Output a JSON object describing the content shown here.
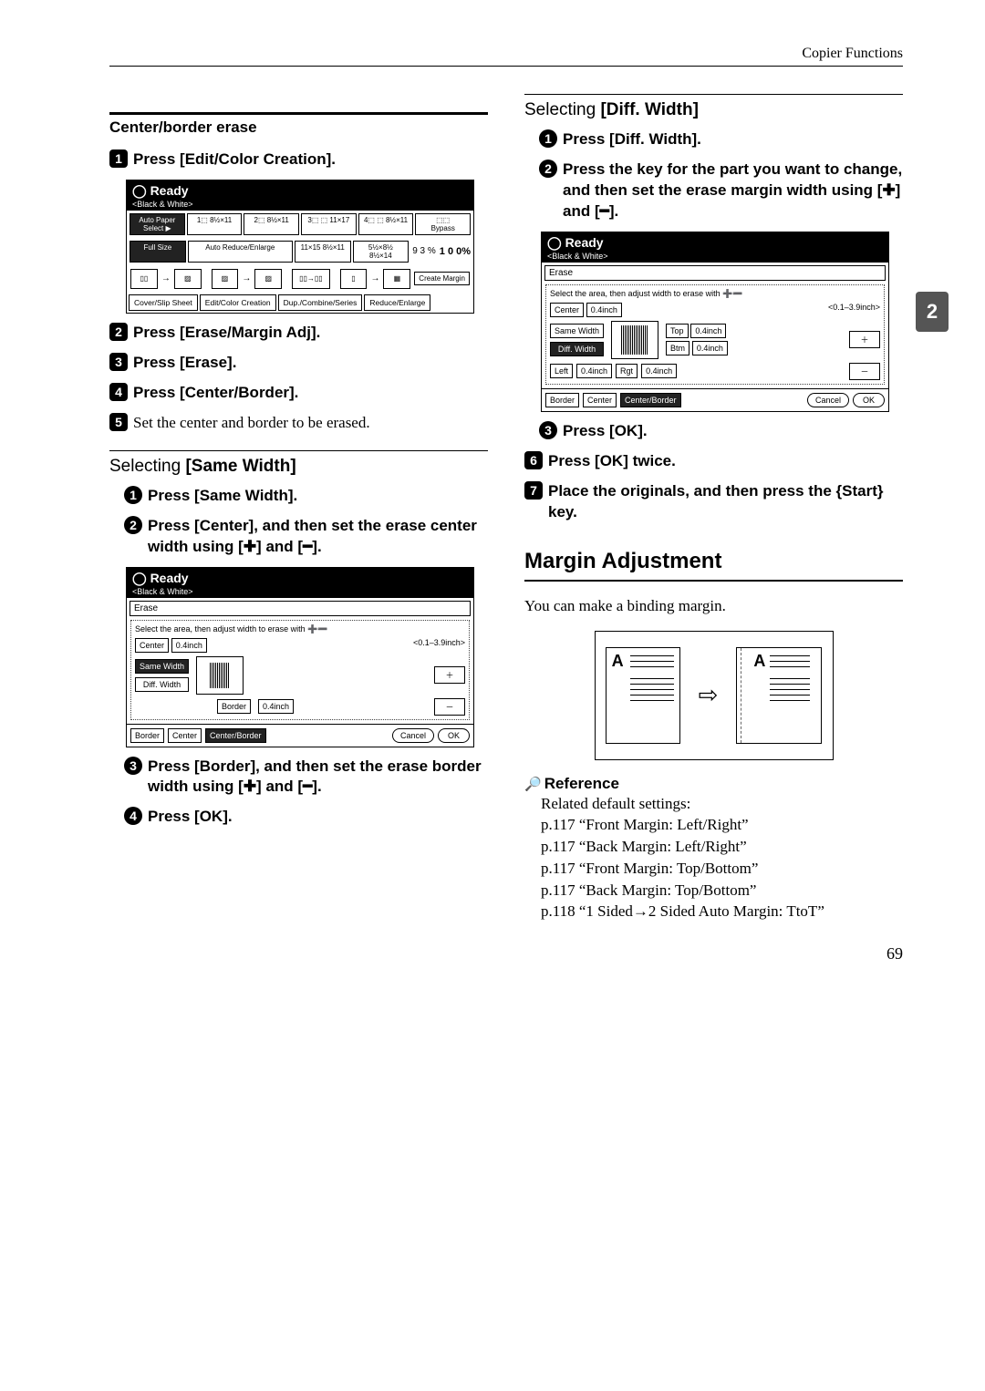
{
  "header": {
    "section": "Copier Functions"
  },
  "page_tab": "2",
  "footer_page": "69",
  "left": {
    "subsection": "Center/border erase",
    "step1": {
      "prefix": "Press ",
      "label": "[Edit/Color Creation]."
    },
    "panel1": {
      "ready": "Ready",
      "mode": "<Black & White>",
      "auto_paper": "Auto Paper\nSelect ▶",
      "p1": "1⬚\n8½×11",
      "p2": "2⬚\n8½×11",
      "p3": "3⬚ ⬚\n11×17",
      "p4": "4⬚ ⬚\n8½×11",
      "full_size": "Full Size",
      "auto_re": "Auto Reduce/Enlarge",
      "s1": "11×15\n8½×11",
      "s2": "5½×8½\n8½×14",
      "ratio": "9 3 %",
      "hundred": "1 0 0%",
      "create_margin": "Create\nMargin",
      "tabs": [
        "Cover/Slip Sheet",
        "Edit/Color Creation",
        "Dup./Combine/Series",
        "Reduce/Enlarge"
      ]
    },
    "step2": {
      "prefix": "Press ",
      "label": "[Erase/Margin Adj]."
    },
    "step3": {
      "prefix": "Press ",
      "label": "[Erase]."
    },
    "step4": {
      "prefix": "Press ",
      "label": "[Center/Border]."
    },
    "step5": {
      "text": "Set the center and border to be erased."
    },
    "selecting1_title": "Selecting ",
    "selecting1_label": "[Same Width]",
    "sub1_step1": {
      "prefix": "Press ",
      "label": "[Same Width]."
    },
    "sub1_step2": {
      "pre": "Press ",
      "label1": "[Center]",
      "mid": ", and then set the erase center width using ",
      "plus": "[✚]",
      "and": " and ",
      "minus": "[━]",
      "end": "."
    },
    "panel2": {
      "ready": "Ready",
      "mode": "<Black & White>",
      "erase": "Erase",
      "instr": "Select the area, then adjust width to erase with ➕➖",
      "center_btn": "Center",
      "center_val": "0.4inch",
      "range": "<0.1–3.9inch>",
      "same_width": "Same Width",
      "diff_width": "Diff. Width",
      "border_btn": "Border",
      "border_val": "0.4inch",
      "bottom": [
        "Border",
        "Center",
        "Center/Border",
        "Cancel",
        "OK"
      ]
    },
    "sub1_step3": {
      "pre": "Press ",
      "label1": "[Border]",
      "mid": ", and then set the erase border width using ",
      "plus": "[✚]",
      "and": " and ",
      "minus": "[━]",
      "end": "."
    },
    "sub1_step4": {
      "prefix": "Press ",
      "label": "[OK]."
    }
  },
  "right": {
    "selecting2_title": "Selecting ",
    "selecting2_label": "[Diff. Width]",
    "sub2_step1": {
      "prefix": "Press ",
      "label": "[Diff. Width]."
    },
    "sub2_step2": {
      "text": "Press the key for the part you want to change, and then set the erase margin width using ",
      "plus": "[✚]",
      "and": " and ",
      "minus": "[━]",
      "end": "."
    },
    "panel3": {
      "ready": "Ready",
      "mode": "<Black & White>",
      "erase": "Erase",
      "instr": "Select the area, then adjust width to erase with ➕➖",
      "center_btn": "Center",
      "center_val": "0.4inch",
      "range": "<0.1–3.9inch>",
      "same_width": "Same Width",
      "diff_width": "Diff. Width",
      "top_btn": "Top",
      "top_val": "0.4inch",
      "btm_btn": "Btm",
      "btm_val": "0.4inch",
      "left_btn": "Left",
      "left_val": "0.4inch",
      "rgt_btn": "Rgt",
      "rgt_val": "0.4inch",
      "bottom": [
        "Border",
        "Center",
        "Center/Border",
        "Cancel",
        "OK"
      ]
    },
    "sub2_step3": {
      "prefix": "Press ",
      "label": "[OK]."
    },
    "step6": {
      "prefix": "Press ",
      "label": "[OK]",
      "suffix": " twice."
    },
    "step7": {
      "pre": "Place the originals, and then press the ",
      "key": "{Start}",
      "post": " key."
    },
    "section": "Margin Adjustment",
    "intro": "You can make a binding margin.",
    "illus_letter": "A",
    "illus_arrow": "⇨",
    "reference_title": "Reference",
    "ref1": "Related default settings:",
    "ref2": "p.117 “Front Margin: Left/Right”",
    "ref3": "p.117 “Back Margin: Left/Right”",
    "ref4": "p.117 “Front Margin: Top/Bottom”",
    "ref5": "p.117 “Back Margin: Top/Bottom”",
    "ref6": "p.118 “1 Sided→2 Sided Auto Margin: TtoT”"
  }
}
